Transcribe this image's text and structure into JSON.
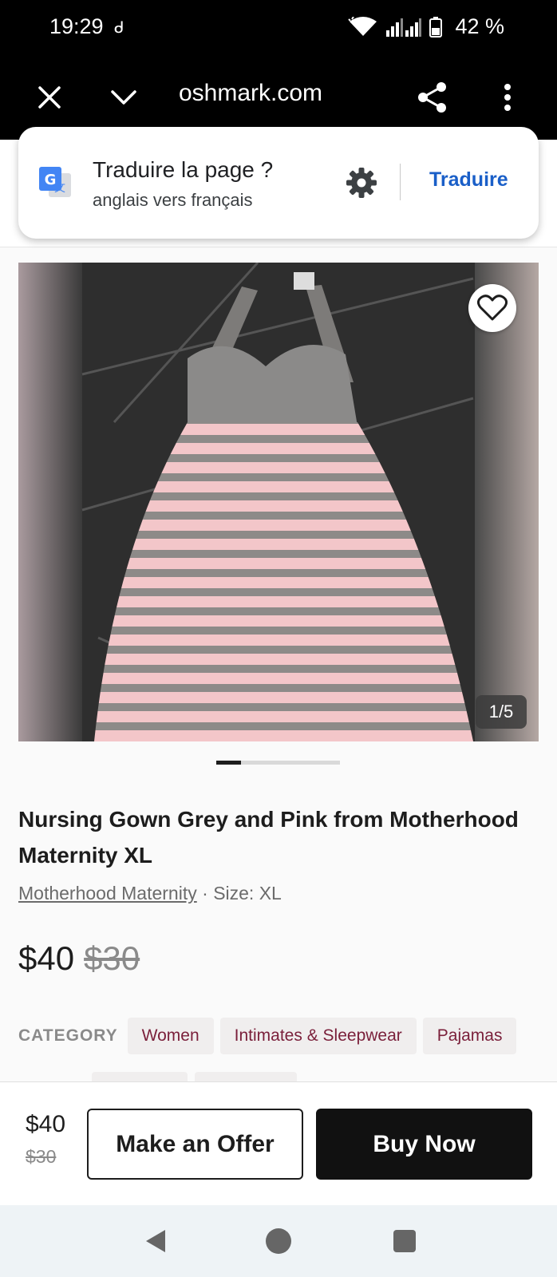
{
  "status_bar": {
    "time": "19:29",
    "battery_percent": "42 %"
  },
  "browser": {
    "url": "oshmark.com",
    "icons": [
      "close-icon",
      "chevron-down-icon",
      "share-icon",
      "more-vert-icon"
    ]
  },
  "translate_prompt": {
    "title": "Traduire la page ?",
    "subtitle": "anglais vers français",
    "action_label": "Traduire",
    "accent_color": "#1a5fc8"
  },
  "gallery": {
    "counter": "1/5",
    "progress_fraction": 0.2
  },
  "product": {
    "title": "Nursing Gown Grey and Pink from Motherhood Maternity XL",
    "brand": "Motherhood Maternity",
    "size": "Size: XL",
    "meta_separator": " · ",
    "price": "$40",
    "original_price": "$30",
    "category_label": "CATEGORY",
    "categories": [
      "Women",
      "Intimates & Sleepwear",
      "Pajamas"
    ]
  },
  "action_bar": {
    "price": "$40",
    "original_price": "$30",
    "offer_label": "Make an Offer",
    "buy_label": "Buy Now"
  },
  "nav_bar": {
    "icons": [
      "back-icon",
      "home-icon",
      "recents-icon"
    ]
  }
}
